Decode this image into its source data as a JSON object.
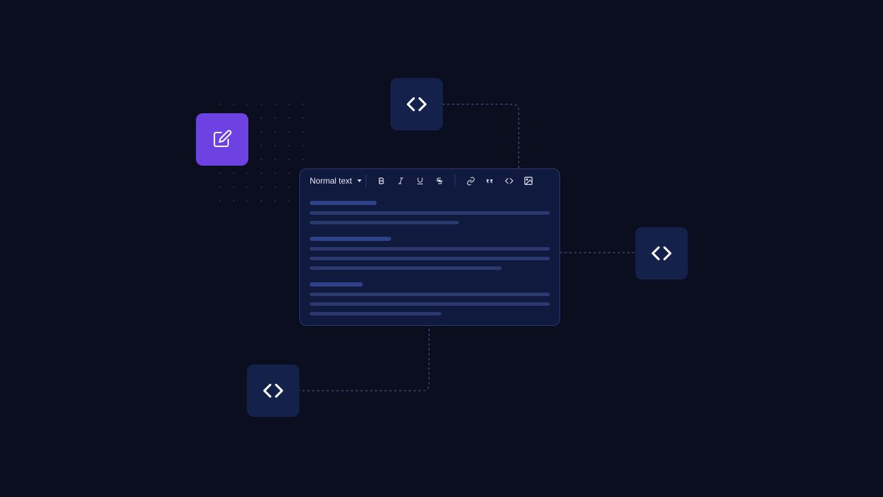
{
  "diagram": {
    "nodes": {
      "edit": {
        "icon": "compose-icon",
        "color": "#6E41E2"
      },
      "code_top": {
        "icon": "code-icon"
      },
      "code_right": {
        "icon": "code-icon"
      },
      "code_bottom": {
        "icon": "code-icon"
      }
    }
  },
  "editor": {
    "toolbar": {
      "style_label": "Normal text",
      "buttons": {
        "bold": "Bold",
        "italic": "Italic",
        "underline": "Underline",
        "strike": "Strikethrough",
        "link": "Link",
        "quote": "Quote",
        "code": "Code",
        "image": "Image"
      }
    }
  }
}
